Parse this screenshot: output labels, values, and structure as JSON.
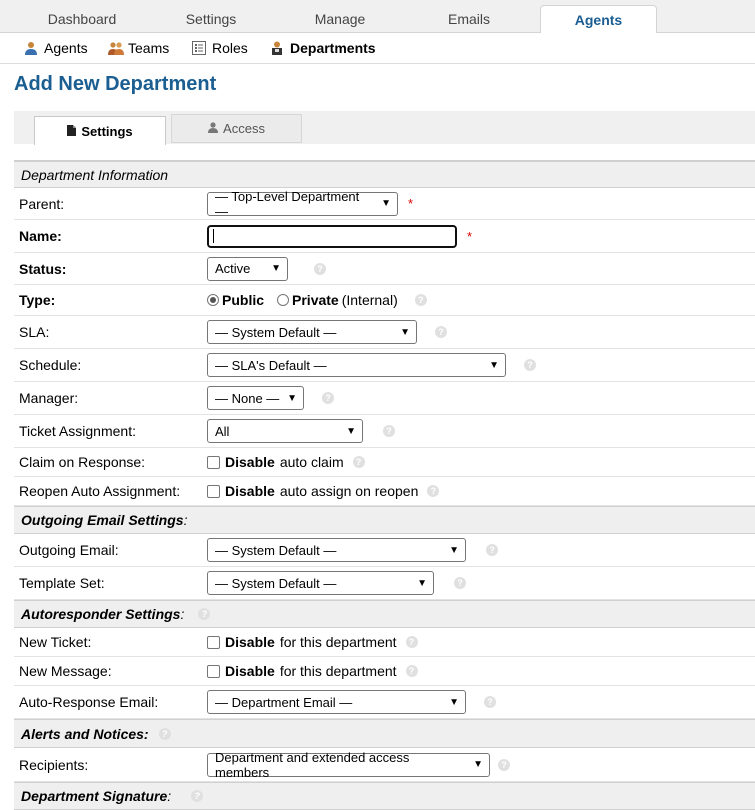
{
  "top_nav": {
    "tabs": [
      {
        "label": "Dashboard"
      },
      {
        "label": "Settings"
      },
      {
        "label": "Manage"
      },
      {
        "label": "Emails"
      },
      {
        "label": "Agents"
      }
    ],
    "active": "Agents"
  },
  "sub_nav": {
    "items": [
      {
        "label": "Agents",
        "icon": "person-icon"
      },
      {
        "label": "Teams",
        "icon": "team-icon"
      },
      {
        "label": "Roles",
        "icon": "roles-icon"
      },
      {
        "label": "Departments",
        "icon": "department-icon"
      }
    ],
    "active": "Departments"
  },
  "page_title": "Add New Department",
  "form_tabs": [
    {
      "label": "Settings",
      "icon": "file-icon"
    },
    {
      "label": "Access",
      "icon": "person-icon"
    }
  ],
  "sections": {
    "department_info": "Department Information",
    "outgoing_email": "Outgoing Email Settings",
    "autoresponder": "Autoresponder Settings",
    "alerts": "Alerts and Notices:",
    "signature": "Department Signature"
  },
  "fields": {
    "parent": {
      "label": "Parent:",
      "value": "— Top-Level Department —"
    },
    "name": {
      "label": "Name:",
      "value": ""
    },
    "status": {
      "label": "Status:",
      "value": "Active"
    },
    "type": {
      "label": "Type:",
      "public": "Public",
      "private": "Private",
      "private_note": "(Internal)",
      "selected": "Public"
    },
    "sla": {
      "label": "SLA:",
      "value": "— System Default —"
    },
    "schedule": {
      "label": "Schedule:",
      "value": "— SLA's Default —"
    },
    "manager": {
      "label": "Manager:",
      "value": "— None —"
    },
    "ticket_assignment": {
      "label": "Ticket Assignment:",
      "value": "All"
    },
    "claim_on_response": {
      "label": "Claim on Response:",
      "bold": "Disable",
      "text": "auto claim",
      "checked": false
    },
    "reopen_auto_assignment": {
      "label": "Reopen Auto Assignment:",
      "bold": "Disable",
      "text": "auto assign on reopen",
      "checked": false
    },
    "outgoing_email": {
      "label": "Outgoing Email:",
      "value": "— System Default —"
    },
    "template_set": {
      "label": "Template Set:",
      "value": "— System Default —"
    },
    "new_ticket": {
      "label": "New Ticket:",
      "bold": "Disable",
      "text": "for this department",
      "checked": false
    },
    "new_message": {
      "label": "New Message:",
      "bold": "Disable",
      "text": "for this department",
      "checked": false
    },
    "auto_response_email": {
      "label": "Auto-Response Email:",
      "value": "— Department Email —"
    },
    "recipients": {
      "label": "Recipients:",
      "value": "Department and extended access members"
    }
  },
  "required_mark": "*",
  "colors": {
    "accent": "#1b5e91",
    "required": "#dd0000"
  }
}
